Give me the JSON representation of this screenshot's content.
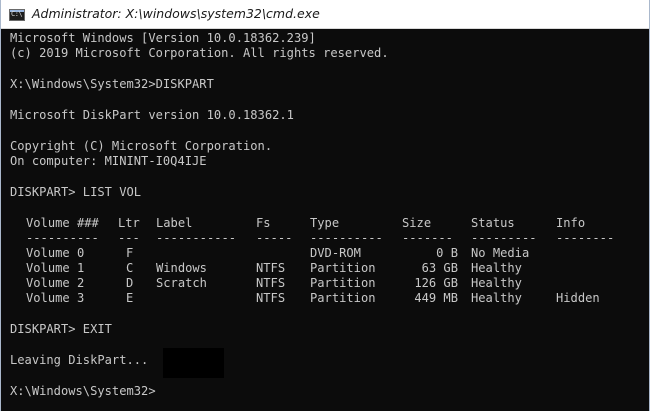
{
  "window": {
    "title": "Administrator: X:\\windows\\system32\\cmd.exe",
    "icon": "cmd-icon",
    "icon_text": "C:\\"
  },
  "console": {
    "banner_1": "Microsoft Windows [Version 10.0.18362.239]",
    "banner_2": "(c) 2019 Microsoft Corporation. All rights reserved.",
    "command_1": "X:\\Windows\\System32>DISKPART",
    "diskpart_version": "Microsoft DiskPart version 10.0.18362.1",
    "copyright": "Copyright (C) Microsoft Corporation.",
    "computer": "On computer: MININT-I0Q4IJE",
    "command_2": "DISKPART> LIST VOL",
    "command_3": "DISKPART> EXIT",
    "leaving": "Leaving DiskPart...",
    "final_prompt": "X:\\Windows\\System32>"
  },
  "volume_table": {
    "headers": {
      "volume": "Volume ###",
      "ltr": "Ltr",
      "label": "Label",
      "fs": "Fs",
      "type": "Type",
      "size": "Size",
      "status": "Status",
      "info": "Info"
    },
    "separators": {
      "volume": "----------",
      "ltr": "---",
      "label": "-----------",
      "fs": "-----",
      "type": "----------",
      "size": "-------",
      "status": "---------",
      "info": "--------"
    },
    "rows": [
      {
        "volume": "Volume 0",
        "ltr": "F",
        "label": "",
        "fs": "",
        "type": "DVD-ROM",
        "size": "0 B",
        "status": "No Media",
        "info": ""
      },
      {
        "volume": "Volume 1",
        "ltr": "C",
        "label": "Windows",
        "fs": "NTFS",
        "type": "Partition",
        "size": "63 GB",
        "status": "Healthy",
        "info": ""
      },
      {
        "volume": "Volume 2",
        "ltr": "D",
        "label": "Scratch",
        "fs": "NTFS",
        "type": "Partition",
        "size": "126 GB",
        "status": "Healthy",
        "info": ""
      },
      {
        "volume": "Volume 3",
        "ltr": "E",
        "label": "",
        "fs": "NTFS",
        "type": "Partition",
        "size": "449 MB",
        "status": "Healthy",
        "info": "Hidden"
      }
    ]
  }
}
